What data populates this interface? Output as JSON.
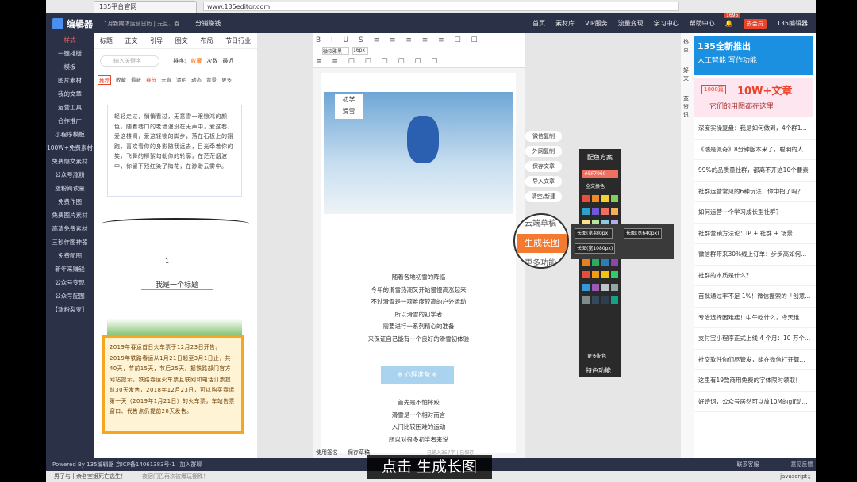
{
  "browser": {
    "tab_title": "135平台官网",
    "url": "www.135editor.com"
  },
  "topnav": {
    "logo": "编辑器",
    "notice": "1月新媒体运营日历 | 元旦、春",
    "promo": "分销赚钱",
    "items": [
      "首页",
      "素材库",
      "VIP服务",
      "流量变现",
      "学习中心",
      "帮助中心"
    ],
    "vip_badge": "去会员",
    "badge_count": "1695",
    "brand_right": "135编辑器"
  },
  "sidebar": {
    "items": [
      "样式",
      "一键排版",
      "模板",
      "图片素材",
      "我的文章",
      "运营工具",
      "合作推广",
      "小程序模板",
      "100W+免费素材",
      "免费爆文素材",
      "公众号涨粉",
      "涨粉阅读量",
      "免费作图",
      "免费图片素材",
      "高清免费素材",
      "三秒作图神器",
      "免费配图",
      "新年来赚钱",
      "公众号变现",
      "公众号配图",
      "【涨粉裂变】"
    ]
  },
  "panel": {
    "tabs": [
      "标题",
      "正文",
      "引导",
      "图文",
      "布局",
      "节日行业"
    ],
    "search_placeholder": "输入关键字",
    "sort_label": "排序:",
    "sort_options": [
      "收藏",
      "次数",
      "最近"
    ],
    "subtabs": [
      "推荐",
      "收藏",
      "最新",
      "春节",
      "元宵",
      "清明",
      "动态",
      "背景",
      "更多"
    ],
    "card1_text": "轻轻走过，悄悄看过，无意雪一眼惊鸿的颜色，随着巷口的老墙漫没在无声中，爱这巷，爱这楼阁，爱这轻锁的脚步，落在石板上的翔跑，喜欢看你的身影随我远去，目光牵着你的笑，飞舞的柳絮勾勒你的轮廓，在茫茫烟波中，你留下残红染了梅花，在渺渺云雾中。",
    "divider_number": "1",
    "title_sample": "我是一个标题",
    "card2_text": "2019年春运首日火车票于12月23日开售。2019年铁路春运从1月21日起至3月1日止，共40天，节前15天，节后25天。据铁路部门官方网站提示，铁路春运火车票互联网和电话订票提前30天发售，2018年12月23日，可以购买春运第一天（2019年1月21日）的火车票，车站售票窗口、代售点仍提前28天发售。"
  },
  "toolbar": {
    "font": "微软雅黑",
    "size": "16px"
  },
  "doc": {
    "image_label_1": "初学",
    "image_label_2": "滑雪",
    "lines": [
      "随着各地初雪的降临",
      "今年的滑雪热潮又开始慢慢高涨起来",
      "不过滑雪是一项难度较高的户外运动",
      "所以滑雪的初学者",
      "需要进行一系列精心的准备",
      "来保证自己能有一个良好的滑雪初体验"
    ],
    "section_title": "心理准备",
    "lines2": [
      "首先是不怕摔跤",
      "滑雪是一个相对而言",
      "入门比较困难的运动",
      "所以对很多初学者来说"
    ],
    "bottom_btns": [
      "使用签名",
      "保存草稿"
    ],
    "status_text": "已输入357字 | 已保存"
  },
  "actions": {
    "items": [
      "微信复制",
      "外网复制",
      "保存文章",
      "导入文章",
      "清空/新建",
      "云端草稿"
    ],
    "long_image": "生成长图",
    "more_label": "更多功能"
  },
  "color_panel": {
    "title": "配色方案",
    "current_hex": "#EF7060",
    "full_text": "全文换色",
    "more": "更多配色",
    "special": "特色功能",
    "swatches": [
      "#e84e3c",
      "#f08a24",
      "#f5d033",
      "#7fcf5a",
      "#2ea1c8",
      "#6e5ad6",
      "#ef7060",
      "#f3b05a",
      "#fce38a",
      "#b7e4a0",
      "#8cc7e6",
      "#b8a9e8",
      "#ffffff",
      "#e0e0e0",
      "#c9c9c9",
      "#9e9e9e",
      "#6d6d6d",
      "#333333",
      "#c0392b",
      "#d35400",
      "#e67e22",
      "#27ae60",
      "#2980b9",
      "#8e44ad",
      "#e74c3c",
      "#f39c12",
      "#f1c40f",
      "#2ecc71",
      "#3498db",
      "#9b59b6",
      "#bdc3c7",
      "#95a5a6",
      "#7f8c8d",
      "#34495e",
      "#2c3e50",
      "#16a085"
    ]
  },
  "long_popup": {
    "opts": [
      "长图(宽480px)",
      "长图(宽640px)",
      "长图(宽1080px)"
    ]
  },
  "hot_tabs": [
    "热点",
    "好文",
    "草资讯"
  ],
  "right_panel": {
    "ad1_line1": "135全新推出",
    "ad1_line2": "人工智能 写作功能",
    "ad2_tag": "1000篇",
    "ad2_line1": "10W+文章",
    "ad2_line2": "它们的用图都在这里",
    "news": [
      "深度实操复盘：我是如何做到，4个群1...",
      "《瑞是佩奇》8分钟版本来了，聪明的人...",
      "99%的品质量社群，都离不开这10个要素",
      "社群运营常见的6种玩法，你中招了吗？",
      "如何运营一个学习成长型社群？",
      "社群营销方法论：IP + 社群 + 场景",
      "微信群带来30%线上订单：步步高如何...",
      "社群的本质是什么？",
      "首批通过率不足 1%！微信搜索的「创意...",
      "专治选择困难症！中午吃什么，今天谁...",
      "支付宝小程序正式上线 4 个月：10 万个...",
      "社交软件你们尽管发，能在微信打开算...",
      "这里有19款商用免费的字体限时领取！",
      "好诗词，公众号居然可以放10M的gif动..."
    ]
  },
  "footer": {
    "left": "Powered By 135编辑器  京ICP备14061383号-1",
    "join": "加入群聊",
    "center": "编辑",
    "contact": "联系客服",
    "feedback": "意见反馈"
  },
  "status": {
    "left": "男子与十余名空姐死亡逃生！",
    "mid": "夜宿门巴再次被爆玩棚殊！",
    "right": "javascript:;"
  },
  "caption": "点击 生成长图"
}
